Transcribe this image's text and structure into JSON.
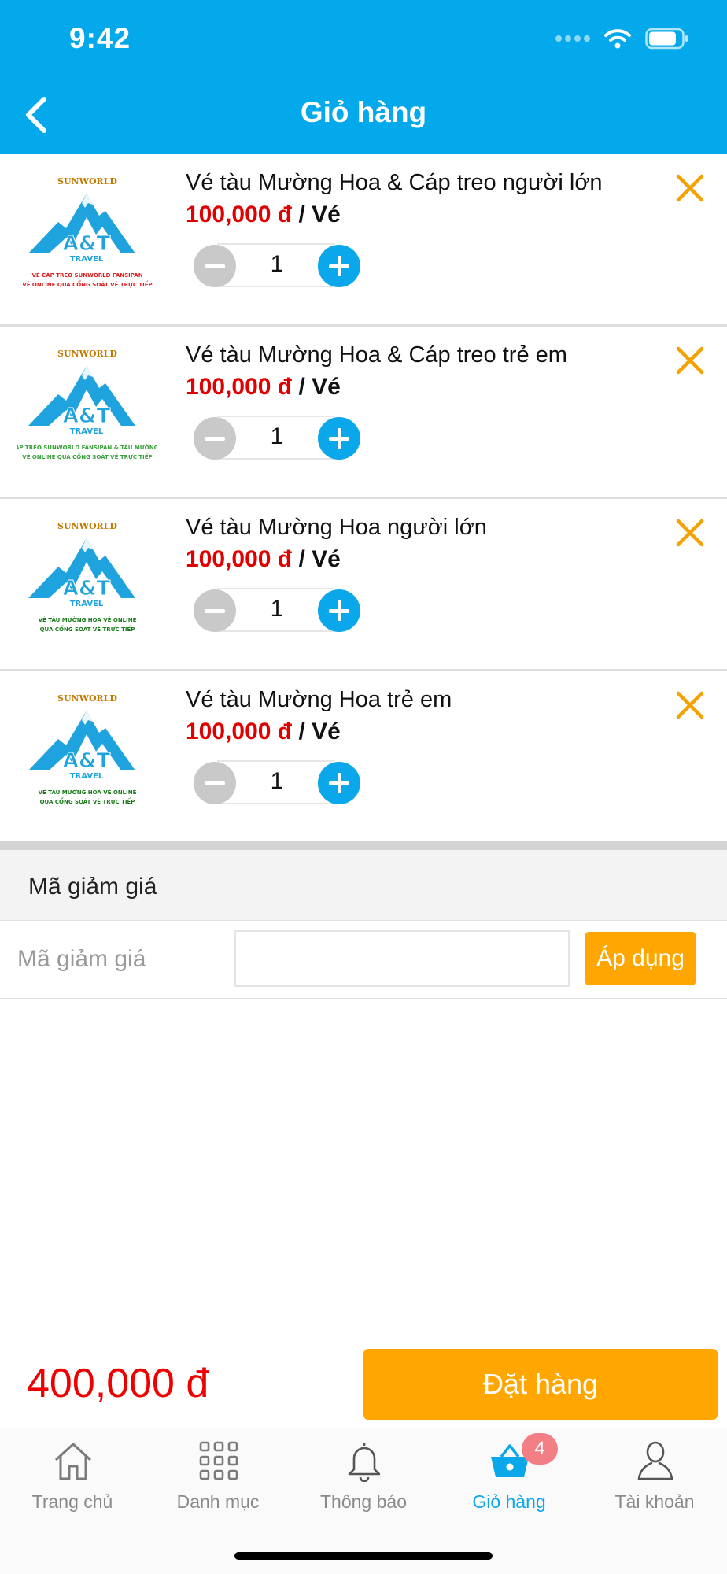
{
  "status_bar": {
    "time": "9:42"
  },
  "header": {
    "title": "Giỏ hàng"
  },
  "cart": {
    "items": [
      {
        "name": "Vé tàu Mường Hoa & Cáp treo người lớn",
        "price": "100,000 đ",
        "unit": " / Vé",
        "quantity": "1",
        "thumb": {
          "brand": "SUNWORLD",
          "logo_text": "A&T",
          "logo_sub": "TRAVEL",
          "caption1": "VÉ CÁP TREO SUNWORLD FANSIPAN",
          "caption2": "VÉ ONLINE QUA CỔNG SOÁT VÉ TRỰC TIẾP",
          "caption_color": "#e02020"
        }
      },
      {
        "name": "Vé tàu Mường Hoa & Cáp treo trẻ em",
        "price": "100,000 đ",
        "unit": " / Vé",
        "quantity": "1",
        "thumb": {
          "brand": "SUNWORLD",
          "logo_text": "A&T",
          "logo_sub": "TRAVEL",
          "caption1": "VÉ CÁP TREO SUNWORLD FANSIPAN & TÀU MƯỜNG HOA",
          "caption2": "VÉ ONLINE QUA CỔNG SOÁT VÉ TRỰC TIẾP",
          "caption_color": "#3aa03a"
        }
      },
      {
        "name": "Vé tàu Mường Hoa người lớn",
        "price": "100,000 đ",
        "unit": " / Vé",
        "quantity": "1",
        "thumb": {
          "brand": "SUNWORLD",
          "logo_text": "A&T",
          "logo_sub": "TRAVEL",
          "caption1": "VÉ TÀU MƯỜNG HOA VÉ ONLINE",
          "caption2": "QUA CỔNG SOÁT VÉ TRỰC TIẾP",
          "caption_color": "#1a7a1a"
        }
      },
      {
        "name": "Vé tàu Mường Hoa trẻ em",
        "price": "100,000 đ",
        "unit": " / Vé",
        "quantity": "1",
        "thumb": {
          "brand": "SUNWORLD",
          "logo_text": "A&T",
          "logo_sub": "TRAVEL",
          "caption1": "VÉ TÀU MƯỜNG HOA VÉ ONLINE",
          "caption2": "QUA CỔNG SOÁT VÉ TRỰC TIẾP",
          "caption_color": "#1a7a1a"
        }
      }
    ]
  },
  "discount": {
    "section_title": "Mã giảm giá",
    "label": "Mã giảm giá",
    "input_value": "",
    "input_placeholder": "",
    "apply_label": "Áp dụng"
  },
  "summary": {
    "total": "400,000 đ",
    "order_label": "Đặt hàng"
  },
  "tabbar": {
    "tabs": [
      {
        "label": "Trang chủ",
        "icon": "home-icon"
      },
      {
        "label": "Danh mục",
        "icon": "grid-icon"
      },
      {
        "label": "Thông báo",
        "icon": "bell-icon"
      },
      {
        "label": "Giỏ hàng",
        "icon": "basket-icon",
        "badge": "4",
        "active": true
      },
      {
        "label": "Tài khoản",
        "icon": "user-icon"
      }
    ]
  },
  "colors": {
    "primary": "#03a9ea",
    "accent": "#ffa700",
    "price": "#e00000",
    "badge": "#f37f86"
  }
}
